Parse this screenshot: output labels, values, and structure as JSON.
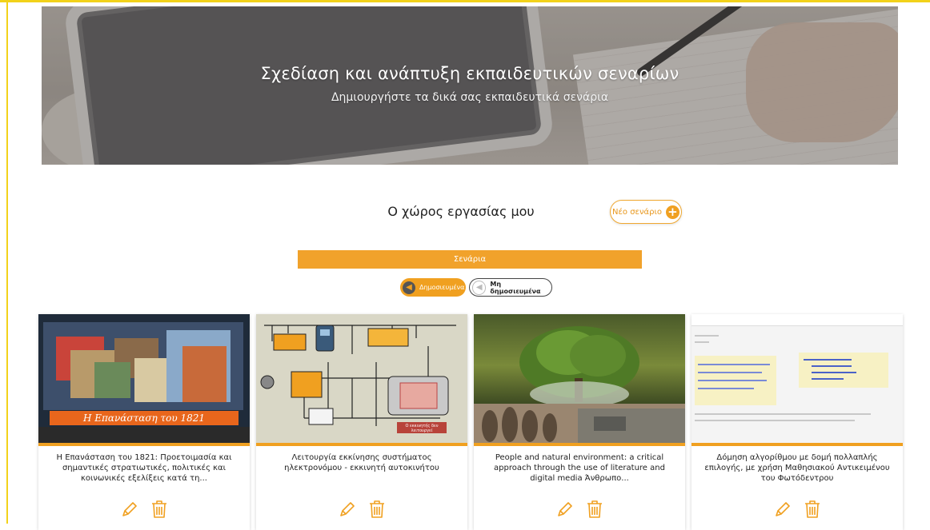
{
  "hero": {
    "title": "Σχεδίαση και ανάπτυξη εκπαιδευτικών σεναρίων",
    "subtitle": "Δημιουργήστε τα δικά σας εκπαιδευτικά σενάρια"
  },
  "workspace": {
    "title": "Ο χώρος εργασίας μου",
    "new_button": "Νέο σενάριο"
  },
  "section_bar": "Σενάρια",
  "filters": {
    "published": "Δημοσιευμένα",
    "unpublished": "Μη δημοσιευμένα"
  },
  "cards": [
    {
      "title": "Η Επανάσταση του 1821: Προετοιμασία και σημαντικές στρατιωτικές, πολιτικές και κοινωνικές εξελίξεις κατά τη...",
      "thumb_banner": "Η Επανάσταση του 1821"
    },
    {
      "title": "Λειτουργία εκκίνησης συστήματος ηλεκτρονόμου - εκκινητή αυτοκινήτου",
      "thumb_caption": "Ο εκκινητής δεν λειτουργεί"
    },
    {
      "title": "People and natural environment: a critical approach through the use of literature and digital media Άνθρωπο..."
    },
    {
      "title": "Δόμηση αλγορίθμου με δομή πολλαπλής επιλογής, με χρήση Μαθησιακού Αντικειμένου του Φωτόδεντρου"
    }
  ],
  "icons": {
    "edit": "pencil-icon",
    "delete": "trash-icon"
  },
  "colors": {
    "accent": "#f0a020",
    "frame": "#f2d21a"
  }
}
